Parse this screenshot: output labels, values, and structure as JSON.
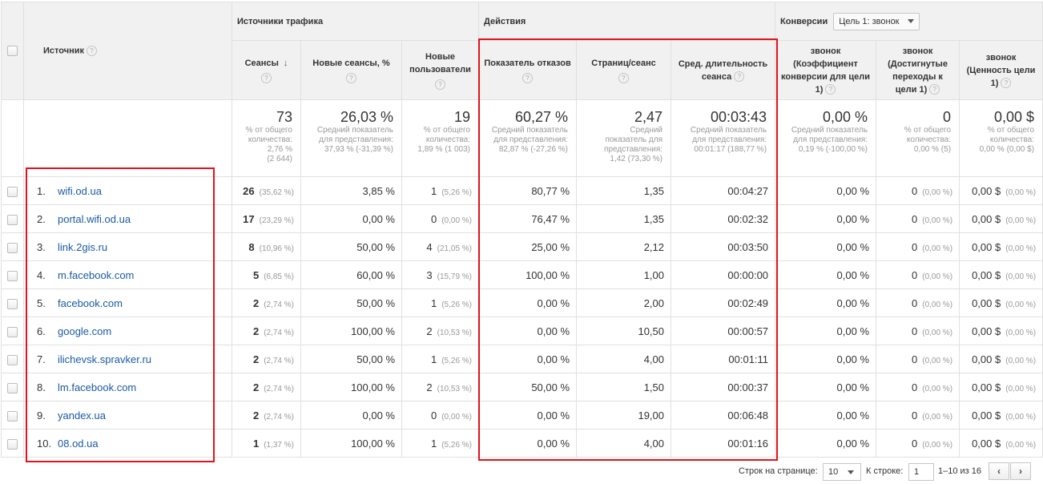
{
  "header": {
    "source_label": "Источник",
    "group_traffic": "Источники трафика",
    "group_actions": "Действия",
    "group_conversions": "Конверсии",
    "goal_select": "Цель 1: звонок",
    "sort_arrow": "↓",
    "help_glyph": "?",
    "columns": [
      "Сеансы",
      "Новые сеансы, %",
      "Новые пользователи",
      "Показатель отказов",
      "Страниц/сеанс",
      "Сред. длительность сеанса",
      "звонок (Коэффициент конверсии для цели 1)",
      "звонок (Достигнутые переходы к цели 1)",
      "звонок (Ценность цели 1)"
    ]
  },
  "totals": [
    {
      "big": "73",
      "l1": "% от общего",
      "l2": "количества:",
      "l3": "2,76 %",
      "l4": "(2 644)"
    },
    {
      "big": "26,03 %",
      "l1": "Средний показатель",
      "l2": "для представления:",
      "l3": "37,93 % (-31,39 %)",
      "l4": ""
    },
    {
      "big": "19",
      "l1": "% от общего",
      "l2": "количества:",
      "l3": "1,89 % (1 003)",
      "l4": ""
    },
    {
      "big": "60,27 %",
      "l1": "Средний показатель",
      "l2": "для представления:",
      "l3": "82,87 % (-27,26 %)",
      "l4": ""
    },
    {
      "big": "2,47",
      "l1": "Средний",
      "l2": "показатель для",
      "l3": "представления:",
      "l4": "1,42 (73,30 %)"
    },
    {
      "big": "00:03:43",
      "l1": "Средний показатель",
      "l2": "для представления:",
      "l3": "00:01:17 (188,77 %)",
      "l4": ""
    },
    {
      "big": "0,00 %",
      "l1": "Средний показатель",
      "l2": "для представления:",
      "l3": "0,19 % (-100,00 %)",
      "l4": ""
    },
    {
      "big": "0",
      "l1": "% от общего",
      "l2": "количества:",
      "l3": "0,00 % (5)",
      "l4": ""
    },
    {
      "big": "0,00 $",
      "l1": "% от общего",
      "l2": "количества:",
      "l3": "0,00 % (0,00 $)",
      "l4": ""
    }
  ],
  "rows": [
    {
      "idx": "1.",
      "source": "wifi.od.ua",
      "sessions": "26",
      "sessions_pct": "(35,62 %)",
      "new_pct": "3,85 %",
      "new_users": "1",
      "new_users_pct": "(5,26 %)",
      "bounce": "80,77 %",
      "pages": "1,35",
      "duration": "00:04:27",
      "conv_rate": "0,00 %",
      "goal_comp": "0",
      "goal_comp_pct": "(0,00 %)",
      "goal_val": "0,00 $",
      "goal_val_pct": "(0,00 %)"
    },
    {
      "idx": "2.",
      "source": "portal.wifi.od.ua",
      "sessions": "17",
      "sessions_pct": "(23,29 %)",
      "new_pct": "0,00 %",
      "new_users": "0",
      "new_users_pct": "(0,00 %)",
      "bounce": "76,47 %",
      "pages": "1,35",
      "duration": "00:02:32",
      "conv_rate": "0,00 %",
      "goal_comp": "0",
      "goal_comp_pct": "(0,00 %)",
      "goal_val": "0,00 $",
      "goal_val_pct": "(0,00 %)"
    },
    {
      "idx": "3.",
      "source": "link.2gis.ru",
      "sessions": "8",
      "sessions_pct": "(10,96 %)",
      "new_pct": "50,00 %",
      "new_users": "4",
      "new_users_pct": "(21,05 %)",
      "bounce": "25,00 %",
      "pages": "2,12",
      "duration": "00:03:50",
      "conv_rate": "0,00 %",
      "goal_comp": "0",
      "goal_comp_pct": "(0,00 %)",
      "goal_val": "0,00 $",
      "goal_val_pct": "(0,00 %)"
    },
    {
      "idx": "4.",
      "source": "m.facebook.com",
      "sessions": "5",
      "sessions_pct": "(6,85 %)",
      "new_pct": "60,00 %",
      "new_users": "3",
      "new_users_pct": "(15,79 %)",
      "bounce": "100,00 %",
      "pages": "1,00",
      "duration": "00:00:00",
      "conv_rate": "0,00 %",
      "goal_comp": "0",
      "goal_comp_pct": "(0,00 %)",
      "goal_val": "0,00 $",
      "goal_val_pct": "(0,00 %)"
    },
    {
      "idx": "5.",
      "source": "facebook.com",
      "sessions": "2",
      "sessions_pct": "(2,74 %)",
      "new_pct": "50,00 %",
      "new_users": "1",
      "new_users_pct": "(5,26 %)",
      "bounce": "0,00 %",
      "pages": "2,00",
      "duration": "00:02:49",
      "conv_rate": "0,00 %",
      "goal_comp": "0",
      "goal_comp_pct": "(0,00 %)",
      "goal_val": "0,00 $",
      "goal_val_pct": "(0,00 %)"
    },
    {
      "idx": "6.",
      "source": "google.com",
      "sessions": "2",
      "sessions_pct": "(2,74 %)",
      "new_pct": "100,00 %",
      "new_users": "2",
      "new_users_pct": "(10,53 %)",
      "bounce": "0,00 %",
      "pages": "10,50",
      "duration": "00:00:57",
      "conv_rate": "0,00 %",
      "goal_comp": "0",
      "goal_comp_pct": "(0,00 %)",
      "goal_val": "0,00 $",
      "goal_val_pct": "(0,00 %)"
    },
    {
      "idx": "7.",
      "source": "ilichevsk.spravker.ru",
      "sessions": "2",
      "sessions_pct": "(2,74 %)",
      "new_pct": "50,00 %",
      "new_users": "1",
      "new_users_pct": "(5,26 %)",
      "bounce": "0,00 %",
      "pages": "4,00",
      "duration": "00:01:11",
      "conv_rate": "0,00 %",
      "goal_comp": "0",
      "goal_comp_pct": "(0,00 %)",
      "goal_val": "0,00 $",
      "goal_val_pct": "(0,00 %)"
    },
    {
      "idx": "8.",
      "source": "lm.facebook.com",
      "sessions": "2",
      "sessions_pct": "(2,74 %)",
      "new_pct": "100,00 %",
      "new_users": "2",
      "new_users_pct": "(10,53 %)",
      "bounce": "50,00 %",
      "pages": "1,50",
      "duration": "00:00:37",
      "conv_rate": "0,00 %",
      "goal_comp": "0",
      "goal_comp_pct": "(0,00 %)",
      "goal_val": "0,00 $",
      "goal_val_pct": "(0,00 %)"
    },
    {
      "idx": "9.",
      "source": "yandex.ua",
      "sessions": "2",
      "sessions_pct": "(2,74 %)",
      "new_pct": "0,00 %",
      "new_users": "0",
      "new_users_pct": "(0,00 %)",
      "bounce": "0,00 %",
      "pages": "19,00",
      "duration": "00:06:48",
      "conv_rate": "0,00 %",
      "goal_comp": "0",
      "goal_comp_pct": "(0,00 %)",
      "goal_val": "0,00 $",
      "goal_val_pct": "(0,00 %)"
    },
    {
      "idx": "10.",
      "source": "08.od.ua",
      "sessions": "1",
      "sessions_pct": "(1,37 %)",
      "new_pct": "100,00 %",
      "new_users": "1",
      "new_users_pct": "(5,26 %)",
      "bounce": "0,00 %",
      "pages": "4,00",
      "duration": "00:01:16",
      "conv_rate": "0,00 %",
      "goal_comp": "0",
      "goal_comp_pct": "(0,00 %)",
      "goal_val": "0,00 $",
      "goal_val_pct": "(0,00 %)"
    }
  ],
  "footer": {
    "rows_per_page_label": "Строк на странице:",
    "rows_per_page_value": "10",
    "goto_label": "К строке:",
    "goto_value": "1",
    "range_label": "1–10 из 16",
    "prev": "‹",
    "next": "›"
  },
  "colors": {
    "highlight": "#e3121b",
    "link": "#1a5aa6"
  }
}
